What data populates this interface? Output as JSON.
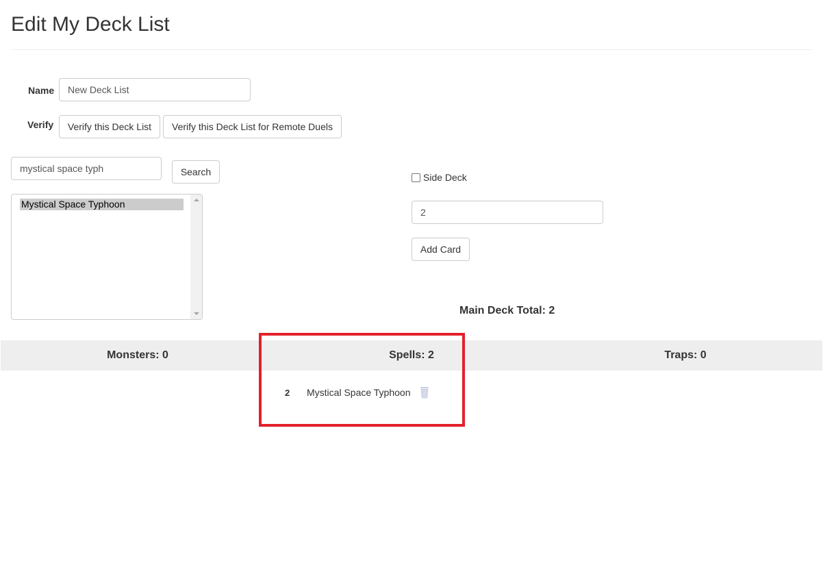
{
  "page": {
    "title": "Edit My Deck List"
  },
  "form": {
    "name_label": "Name",
    "name_value": "New Deck List",
    "verify_label": "Verify",
    "verify_button": "Verify this Deck List",
    "verify_remote_button": "Verify this Deck List for Remote Duels"
  },
  "search": {
    "query": "mystical space typh",
    "button": "Search",
    "results": [
      "Mystical Space Typhoon"
    ],
    "selected_index": 0
  },
  "add_card": {
    "side_deck_label": "Side Deck",
    "side_deck_checked": false,
    "quantity": "2",
    "button": "Add Card"
  },
  "summary": {
    "main_deck_total": "Main Deck Total: 2",
    "monsters": "Monsters: 0",
    "spells": "Spells: 2",
    "traps": "Traps: 0"
  },
  "spell_cards": [
    {
      "qty": "2",
      "name": "Mystical Space Typhoon",
      "action_icon": "trash-icon"
    }
  ],
  "colors": {
    "category_bar": "#eeeeee",
    "highlight": "#e2202b",
    "selected_option": "#cccccc"
  }
}
